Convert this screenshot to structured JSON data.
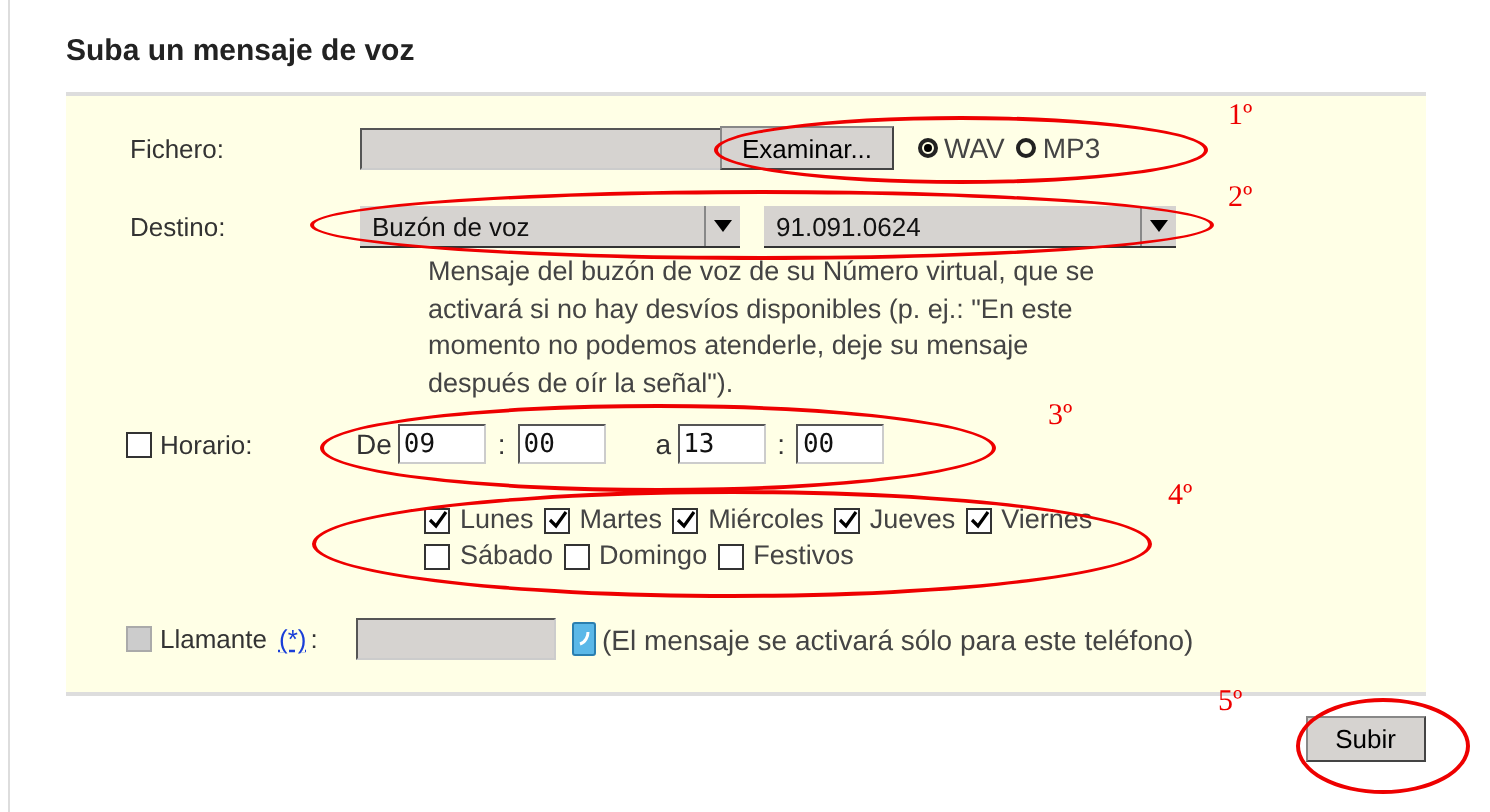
{
  "title": "Suba un mensaje de voz",
  "file": {
    "label": "Fichero:",
    "browse": "Examinar...",
    "formats": [
      {
        "label": "WAV",
        "selected": true
      },
      {
        "label": "MP3",
        "selected": false
      }
    ]
  },
  "destination": {
    "label": "Destino:",
    "type": "Buzón de voz",
    "number": "91.091.0624",
    "description": "Mensaje del buzón de voz de su Número virtual, que se activará si no hay desvíos disponibles (p. ej.: \"En este momento no podemos atenderle, deje su mensaje después de oír la señal\")."
  },
  "schedule": {
    "label": "Horario:",
    "checked": false,
    "from_label": "De",
    "from_hour": "09",
    "from_minute": "00",
    "to_label": "a",
    "to_hour": "13",
    "to_minute": "00",
    "separator": ":"
  },
  "days": [
    [
      {
        "label": "Lunes",
        "checked": true
      },
      {
        "label": "Martes",
        "checked": true
      },
      {
        "label": "Miércoles",
        "checked": true
      },
      {
        "label": "Jueves",
        "checked": true
      },
      {
        "label": "Viernes",
        "checked": true
      }
    ],
    [
      {
        "label": "Sábado",
        "checked": false
      },
      {
        "label": "Domingo",
        "checked": false
      },
      {
        "label": "Festivos",
        "checked": false
      }
    ]
  ],
  "caller": {
    "label": "Llamante",
    "link": "(*)",
    "colon": ":",
    "disabled": true,
    "note": "(El mensaje se activará sólo para este teléfono)"
  },
  "submit": "Subir",
  "annotations": [
    "1º",
    "2º",
    "3º",
    "4º",
    "5º"
  ]
}
